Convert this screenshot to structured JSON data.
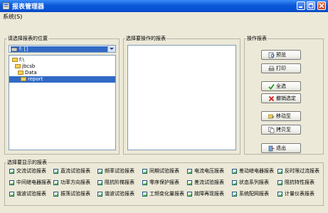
{
  "window": {
    "title": "报表管理器"
  },
  "menu": {
    "items": [
      "系统(S)"
    ]
  },
  "left_panel": {
    "group_label": "请选择报表的位置",
    "drive": "f: []",
    "tree": [
      {
        "label": "f:\\"
      },
      {
        "label": "jbcsb"
      },
      {
        "label": "Data"
      },
      {
        "label": "report"
      }
    ]
  },
  "middle_panel": {
    "group_label": "选择要操作的报表"
  },
  "right_panel": {
    "group_label": "操作报表",
    "buttons": [
      {
        "label": "预览",
        "icon": "preview-icon"
      },
      {
        "label": "打印",
        "icon": "print-icon"
      },
      {
        "label": "全选",
        "icon": "checkmark-icon"
      },
      {
        "label": "撤销选定",
        "icon": "red-x-icon"
      },
      {
        "label": "移动至",
        "icon": "move-icon"
      },
      {
        "label": "拷贝至",
        "icon": "copy-icon"
      },
      {
        "label": "退出",
        "icon": "exit-icon"
      }
    ]
  },
  "bottom_panel": {
    "group_label": "选择要显示的报表",
    "checkboxes": [
      [
        "交流试验报表",
        "直流试验报表",
        "频率试验报表",
        "同期试验报表",
        "电流电压报表",
        "差动继电器报表",
        "反时限过流报表"
      ],
      [
        "中间继电器报表",
        "功率方向报表",
        "阻抗阶梯报表",
        "零序保护报表",
        "差流试验报表",
        "状态系列报表",
        "阻抗特性报表"
      ],
      [
        "谐波试验报表",
        "振荡试验报表",
        "谐波试验报表",
        "工频变化量报表",
        "故障再现报表",
        "系统配网报表",
        "计量仪表报表"
      ]
    ],
    "checked": true
  },
  "colors": {
    "titlebar": "#0a58d7",
    "selection": "#316ac5",
    "face": "#ece9d8"
  }
}
